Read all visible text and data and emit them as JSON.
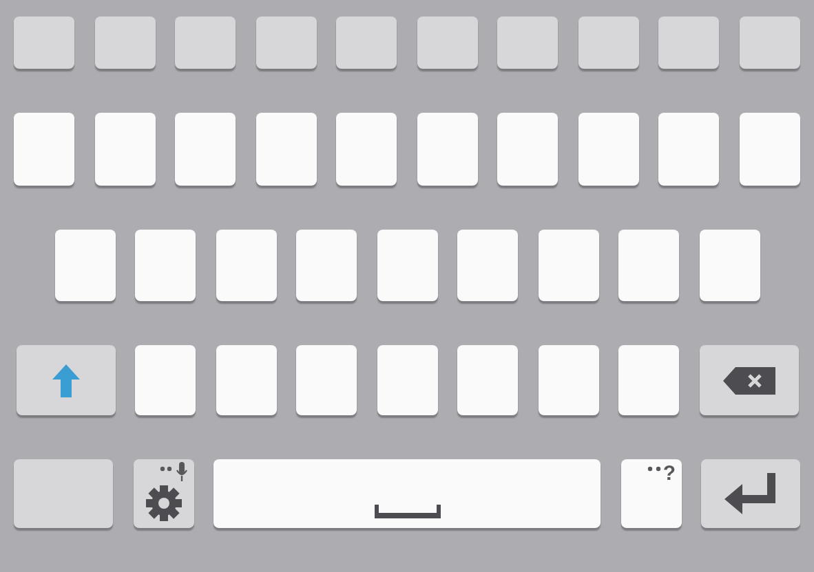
{
  "keyboard": {
    "shift_on": true,
    "rows": [
      {
        "keys": [
          {
            "kind": "plain"
          },
          {
            "kind": "plain"
          },
          {
            "kind": "plain"
          },
          {
            "kind": "plain"
          },
          {
            "kind": "plain"
          },
          {
            "kind": "plain"
          },
          {
            "kind": "plain"
          },
          {
            "kind": "plain"
          },
          {
            "kind": "plain"
          },
          {
            "kind": "plain"
          }
        ]
      },
      {
        "keys": [
          {
            "kind": "letter"
          },
          {
            "kind": "letter"
          },
          {
            "kind": "letter"
          },
          {
            "kind": "letter"
          },
          {
            "kind": "letter"
          },
          {
            "kind": "letter"
          },
          {
            "kind": "letter"
          },
          {
            "kind": "letter"
          },
          {
            "kind": "letter"
          },
          {
            "kind": "letter"
          }
        ]
      },
      {
        "keys": [
          {
            "kind": "letter"
          },
          {
            "kind": "letter"
          },
          {
            "kind": "letter"
          },
          {
            "kind": "letter"
          },
          {
            "kind": "letter"
          },
          {
            "kind": "letter"
          },
          {
            "kind": "letter"
          },
          {
            "kind": "letter"
          },
          {
            "kind": "letter"
          }
        ]
      },
      {
        "keys": [
          {
            "kind": "shift"
          },
          {
            "kind": "letter"
          },
          {
            "kind": "letter"
          },
          {
            "kind": "letter"
          },
          {
            "kind": "letter"
          },
          {
            "kind": "letter"
          },
          {
            "kind": "letter"
          },
          {
            "kind": "letter"
          },
          {
            "kind": "backspace"
          }
        ]
      },
      {
        "keys": [
          {
            "kind": "wide"
          },
          {
            "kind": "settings"
          },
          {
            "kind": "space"
          },
          {
            "kind": "punct",
            "hint": "?"
          },
          {
            "kind": "enter"
          }
        ]
      }
    ]
  }
}
